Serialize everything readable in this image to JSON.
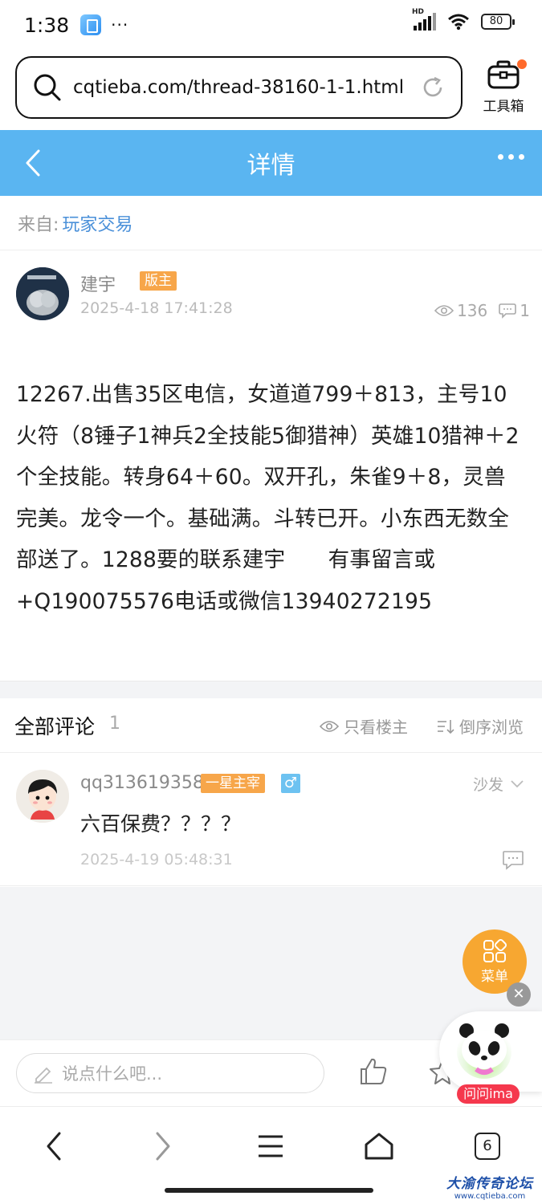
{
  "status_bar": {
    "time": "1:38",
    "more": "···",
    "network": "HD",
    "battery": "80"
  },
  "url_bar": {
    "url": "cqtieba.com/thread-38160-1-1.html",
    "toolbox_label": "工具箱"
  },
  "header": {
    "title": "详情"
  },
  "from": {
    "label": "来自:",
    "board": "玩家交易"
  },
  "post": {
    "author": "建宇",
    "badge": "版主",
    "date": "2025-4-18 17:41:28",
    "views": "136",
    "comments": "1",
    "body": "12267.出售35区电信，女道道799＋813，主号10火符（8锤子1神兵2全技能5御猎神）英雄10猎神＋2个全技能。转身64＋60。双开孔，朱雀9＋8，灵兽完美。龙令一个。基础满。斗转已开。小东西无数全部送了。1288要的联系建宇　　有事留言或+Q190075576电话或微信13940272195"
  },
  "comments_section": {
    "title": "全部评论",
    "count": "1",
    "only_op": "只看楼主",
    "reverse": "倒序浏览"
  },
  "comments": [
    {
      "user": "qq313619358",
      "rank": "一星主宰",
      "gender": "♂",
      "floor": "沙发",
      "text": "六百保费？？？？",
      "date": "2025-4-19 05:48:31"
    }
  ],
  "floating": {
    "menu_label": "菜单",
    "close": "✕",
    "ima_label": "问问ima"
  },
  "reply_bar": {
    "placeholder": "说点什么吧..."
  },
  "nav": {
    "tabs_count": "6"
  },
  "watermark": {
    "title": "大渝传奇论坛",
    "url": "www.cqtieba.com"
  }
}
